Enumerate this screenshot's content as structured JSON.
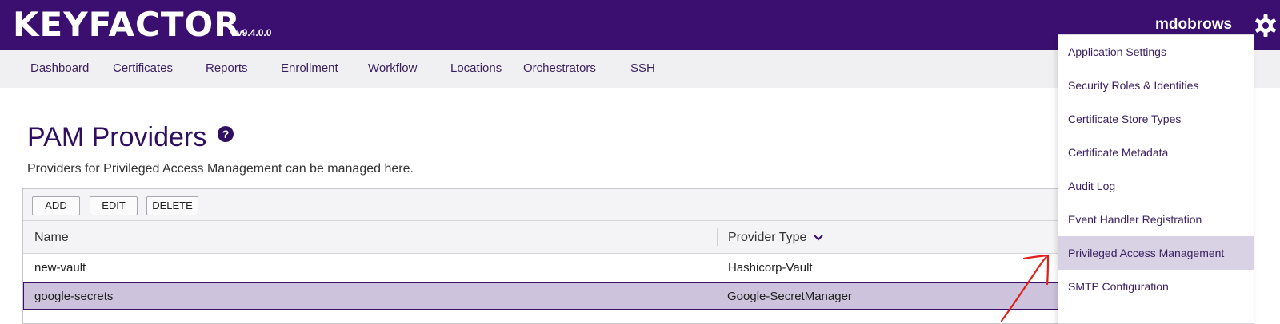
{
  "header": {
    "logo": "KEYFACTOR",
    "version": "v9.4.0.0",
    "username": "mdobrows",
    "settings_icon": "gear-icon"
  },
  "nav": {
    "items": [
      {
        "label": "Dashboard"
      },
      {
        "label": "Certificates"
      },
      {
        "label": "Reports"
      },
      {
        "label": "Enrollment"
      },
      {
        "label": "Workflow"
      },
      {
        "label": "Locations"
      },
      {
        "label": "Orchestrators"
      },
      {
        "label": "SSH"
      }
    ]
  },
  "page": {
    "title": "PAM Providers",
    "help_icon": "help-icon",
    "subtitle": "Providers for Privileged Access Management can be managed here."
  },
  "toolbar": {
    "add_label": "ADD",
    "edit_label": "EDIT",
    "delete_label": "DELETE"
  },
  "table": {
    "columns": [
      "Name",
      "Provider Type"
    ],
    "sort_icon": "chevron-down-icon",
    "rows": [
      {
        "name": "new-vault",
        "provider_type": "Hashicorp-Vault",
        "selected": false
      },
      {
        "name": "google-secrets",
        "provider_type": "Google-SecretManager",
        "selected": true
      }
    ]
  },
  "settings_menu": {
    "items": [
      {
        "label": "Application Settings"
      },
      {
        "label": "Security Roles & Identities"
      },
      {
        "label": "Certificate Store Types"
      },
      {
        "label": "Certificate Metadata"
      },
      {
        "label": "Audit Log"
      },
      {
        "label": "Event Handler Registration"
      },
      {
        "label": "Privileged Access Management",
        "active": true
      },
      {
        "label": "SMTP Configuration"
      }
    ]
  },
  "colors": {
    "brand": "#3a0f6f",
    "selected_row": "#cdc3dd",
    "menu_active": "#d8d2e4",
    "annotation": "#e0201a"
  }
}
